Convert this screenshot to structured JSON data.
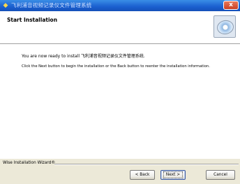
{
  "window": {
    "title": "飞利浦音视频记录仪文件管理系统",
    "close_glyph": "x"
  },
  "header": {
    "title": "Start Installation",
    "icon": "cd-disc-icon"
  },
  "content": {
    "ready_text": "You are now ready to install 飞利浦音视频记录仪文件管理系统.",
    "instruction_text": "Click the Next button to begin the installation or the Back button to reenter the installation information."
  },
  "footer": {
    "wizard_label": "Wise Installation Wizard®"
  },
  "buttons": {
    "back": "< Back",
    "next": "Next >",
    "cancel": "Cancel"
  },
  "colors": {
    "titlebar": "#1a5fcf",
    "close": "#c94024",
    "dialog_bg": "#ece9d8"
  }
}
